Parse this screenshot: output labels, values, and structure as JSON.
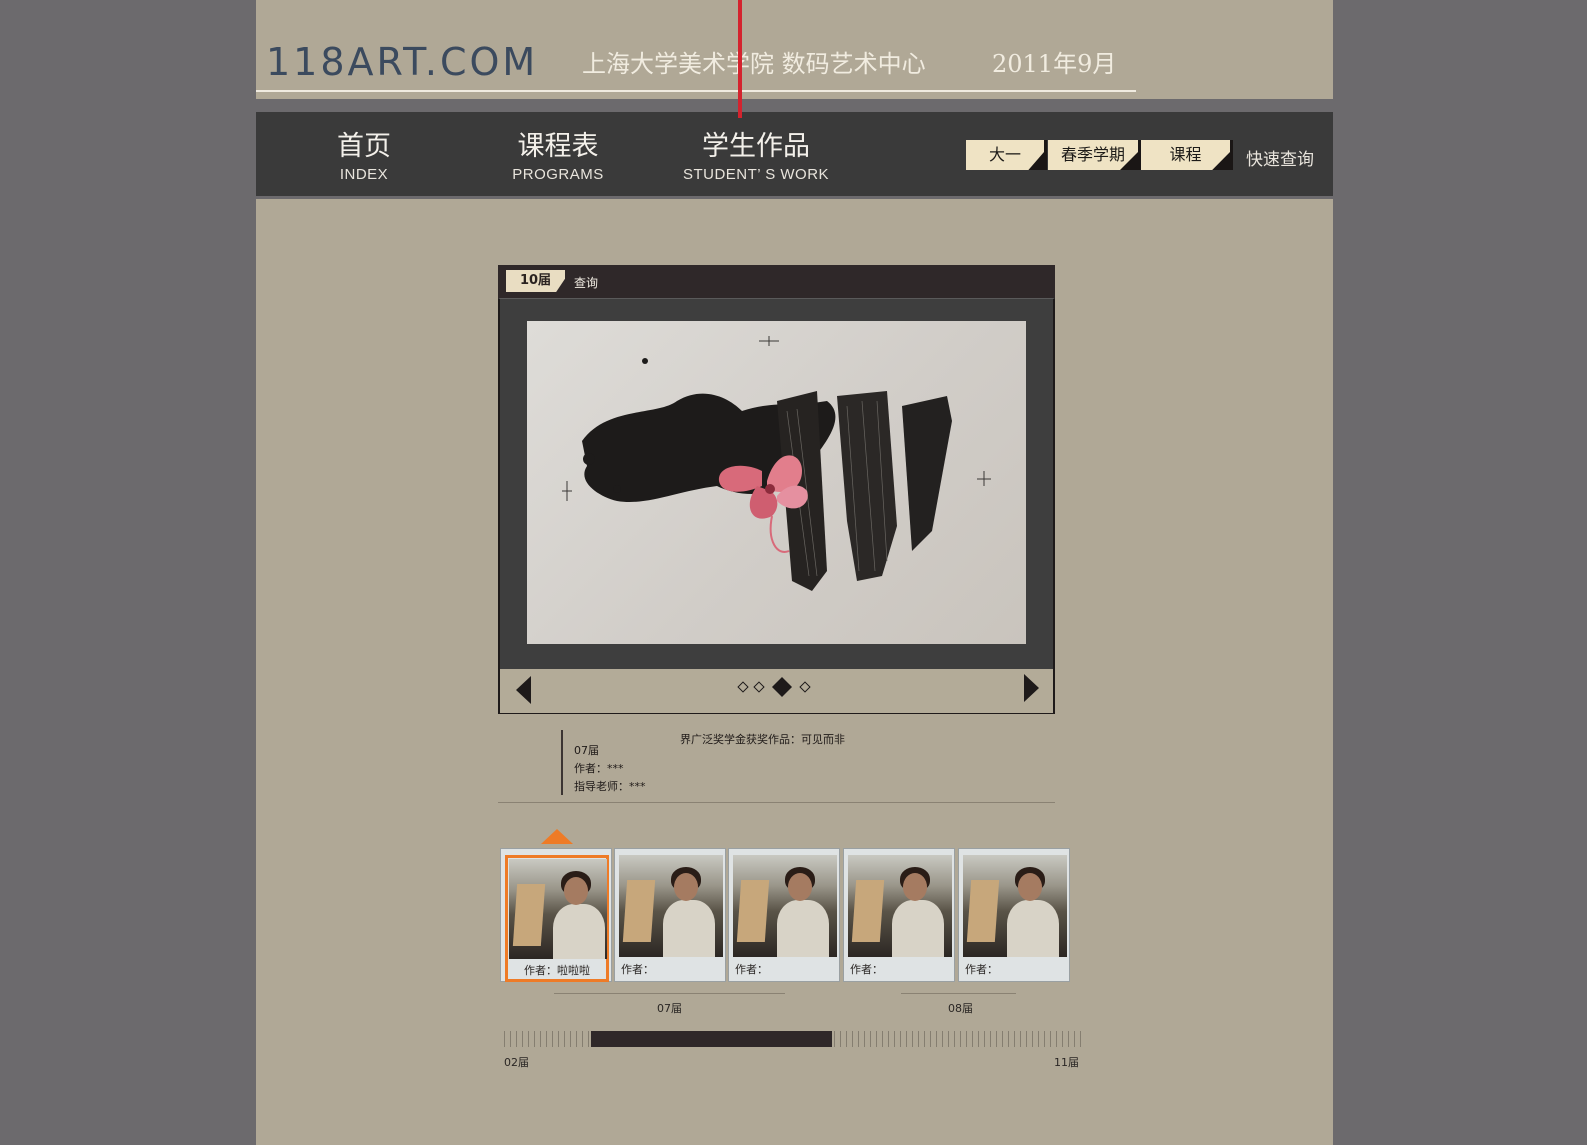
{
  "header": {
    "logo": "118ART.COM",
    "org": "上海大学美术学院  数码艺术中心",
    "date": "2011年9月"
  },
  "nav": {
    "items": [
      {
        "cn": "首页",
        "en": "INDEX"
      },
      {
        "cn": "课程表",
        "en": "PROGRAMS"
      },
      {
        "cn": "学生作品",
        "en": "STUDENT’ S WORK"
      }
    ],
    "filters": [
      "大一",
      "春季学期",
      "课程"
    ],
    "quick_search": "快速查询"
  },
  "viewer": {
    "session_tag": "10届",
    "query_label": "查询",
    "slide_count": 4,
    "active_slide": 3
  },
  "info": {
    "title": "界广泛奖学金获奖作品：可见而非",
    "session": "07届",
    "author": "作者：***",
    "advisor": "指导老师：***"
  },
  "thumbs": [
    {
      "caption": "作者：啦啦啦",
      "active": true
    },
    {
      "caption": "作者：",
      "active": false
    },
    {
      "caption": "作者：",
      "active": false
    },
    {
      "caption": "作者：",
      "active": false
    },
    {
      "caption": "作者：",
      "active": false
    }
  ],
  "groups": {
    "g1": "07届",
    "g2": "08届"
  },
  "range": {
    "start": "02届",
    "end": "11届"
  },
  "colors": {
    "accent_orange": "#ee7b27",
    "red_marker": "#d4232e",
    "nav_bg": "#3a3a3a",
    "page_bg": "#b0a896",
    "pill_bg": "#efe3c4"
  }
}
